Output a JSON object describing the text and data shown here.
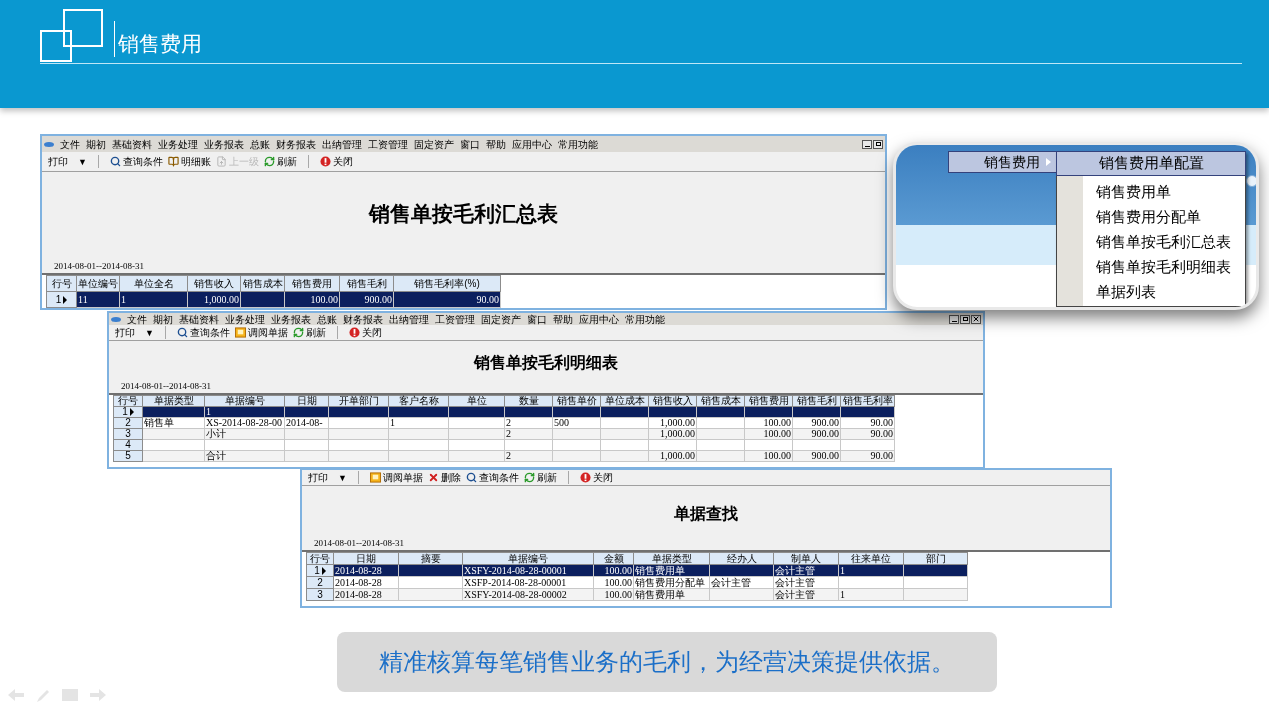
{
  "header": {
    "title": "销售费用"
  },
  "windows": [
    {
      "menu": [
        "文件",
        "期初",
        "基础资料",
        "业务处理",
        "业务报表",
        "总账",
        "财务报表",
        "出纳管理",
        "工资管理",
        "固定资产",
        "窗口",
        "帮助",
        "应用中心",
        "常用功能"
      ],
      "controls": [
        {
          "kind": "minimize"
        },
        {
          "kind": "restore"
        }
      ],
      "toolbar": [
        {
          "kind": "print",
          "label": "打印",
          "caret": "▼",
          "disabled": false
        },
        {
          "kind": "separator"
        },
        {
          "kind": "search",
          "label": "查询条件",
          "disabled": false
        },
        {
          "kind": "ledger",
          "label": "明细账",
          "disabled": false
        },
        {
          "kind": "up",
          "label": "上一级",
          "disabled": true
        },
        {
          "kind": "refresh",
          "label": "刷新",
          "disabled": false
        },
        {
          "kind": "separator"
        },
        {
          "kind": "close",
          "label": "关闭",
          "disabled": false
        }
      ],
      "report_title": "销售单按毛利汇总表",
      "date_range": "2014-08-01--2014-08-31",
      "table": {
        "columns": [
          "行号",
          "单位编号",
          "单位全名",
          "销售收入",
          "销售成本",
          "销售费用",
          "销售毛利",
          "销售毛利率(%)"
        ],
        "rows": [
          {
            "selected": true,
            "cells": [
              "1",
              "11",
              "1",
              "1,000.00",
              "",
              "100.00",
              "900.00",
              "90.00"
            ]
          }
        ]
      }
    },
    {
      "menu": [
        "文件",
        "期初",
        "基础资料",
        "业务处理",
        "业务报表",
        "总账",
        "财务报表",
        "出纳管理",
        "工资管理",
        "固定资产",
        "窗口",
        "帮助",
        "应用中心",
        "常用功能"
      ],
      "controls": [
        {
          "kind": "minimize"
        },
        {
          "kind": "restore"
        },
        {
          "kind": "close"
        }
      ],
      "toolbar": [
        {
          "kind": "print",
          "label": "打印",
          "caret": "▼",
          "disabled": false
        },
        {
          "kind": "separator"
        },
        {
          "kind": "search",
          "label": "查询条件",
          "disabled": false
        },
        {
          "kind": "open",
          "label": "调阅单据",
          "disabled": false
        },
        {
          "kind": "refresh",
          "label": "刷新",
          "disabled": false
        },
        {
          "kind": "separator"
        },
        {
          "kind": "close",
          "label": "关闭",
          "disabled": false
        }
      ],
      "report_title": "销售单按毛利明细表",
      "date_range": "2014-08-01--2014-08-31",
      "table": {
        "columns": [
          "行号",
          "单据类型",
          "单据编号",
          "日期",
          "开单部门",
          "客户名称",
          "单位",
          "数量",
          "销售单价",
          "单位成本",
          "销售收入",
          "销售成本",
          "销售费用",
          "销售毛利",
          "销售毛利率"
        ],
        "rows": [
          {
            "selected": true,
            "cells": [
              "1",
              "",
              "1",
              "",
              "",
              "",
              "",
              "",
              "",
              "",
              "",
              "",
              "",
              "",
              ""
            ]
          },
          {
            "selected": false,
            "cells": [
              "2",
              "销售单",
              "XS-2014-08-28-00",
              "2014-08-",
              "",
              "1",
              "",
              "2",
              "500",
              "",
              "1,000.00",
              "",
              "100.00",
              "900.00",
              "90.00"
            ]
          },
          {
            "selected": false,
            "cells": [
              "3",
              "",
              "小计",
              "",
              "",
              "",
              "",
              "2",
              "",
              "",
              "1,000.00",
              "",
              "100.00",
              "900.00",
              "90.00"
            ]
          },
          {
            "selected": false,
            "cells": [
              "4",
              "",
              "",
              "",
              "",
              "",
              "",
              "",
              "",
              "",
              "",
              "",
              "",
              "",
              ""
            ]
          },
          {
            "selected": false,
            "cells": [
              "5",
              "",
              "合计",
              "",
              "",
              "",
              "",
              "2",
              "",
              "",
              "1,000.00",
              "",
              "100.00",
              "900.00",
              "90.00"
            ]
          }
        ]
      }
    },
    {
      "toolbar": [
        {
          "kind": "print",
          "label": "打印",
          "caret": "▼",
          "disabled": false
        },
        {
          "kind": "separator"
        },
        {
          "kind": "open",
          "label": "调阅单据",
          "disabled": false
        },
        {
          "kind": "delete",
          "label": "删除",
          "disabled": false
        },
        {
          "kind": "search",
          "label": "查询条件",
          "disabled": false
        },
        {
          "kind": "refresh",
          "label": "刷新",
          "disabled": false
        },
        {
          "kind": "separator"
        },
        {
          "kind": "close",
          "label": "关闭",
          "disabled": false
        }
      ],
      "report_title": "单据查找",
      "date_range": "2014-08-01--2014-08-31",
      "table": {
        "columns": [
          "行号",
          "日期",
          "摘要",
          "单据编号",
          "金额",
          "单据类型",
          "经办人",
          "制单人",
          "往来单位",
          "部门"
        ],
        "rows": [
          {
            "selected": true,
            "cells": [
              "1",
              "2014-08-28",
              "",
              "XSFY-2014-08-28-00001",
              "100.00",
              "销售费用单",
              "",
              "会计主管",
              "1",
              ""
            ]
          },
          {
            "selected": false,
            "cells": [
              "2",
              "2014-08-28",
              "",
              "XSFP-2014-08-28-00001",
              "100.00",
              "销售费用分配单",
              "会计主管",
              "会计主管",
              "",
              ""
            ]
          },
          {
            "selected": false,
            "cells": [
              "3",
              "2014-08-28",
              "",
              "XSFY-2014-08-28-00002",
              "100.00",
              "销售费用单",
              "",
              "会计主管",
              "1",
              ""
            ]
          }
        ]
      }
    }
  ],
  "popup_menu": {
    "parent": "销售费用",
    "items": [
      {
        "label": "销售费用单配置",
        "selected": true
      },
      {
        "label": "销售费用单",
        "selected": false
      },
      {
        "label": "销售费用分配单",
        "selected": false
      },
      {
        "label": "销售单按毛利汇总表",
        "selected": false
      },
      {
        "label": "销售单按毛利明细表",
        "selected": false
      },
      {
        "label": "单据列表",
        "selected": false
      }
    ]
  },
  "caption": "精准核算每笔销售业务的毛利，为经营决策提供依据。"
}
